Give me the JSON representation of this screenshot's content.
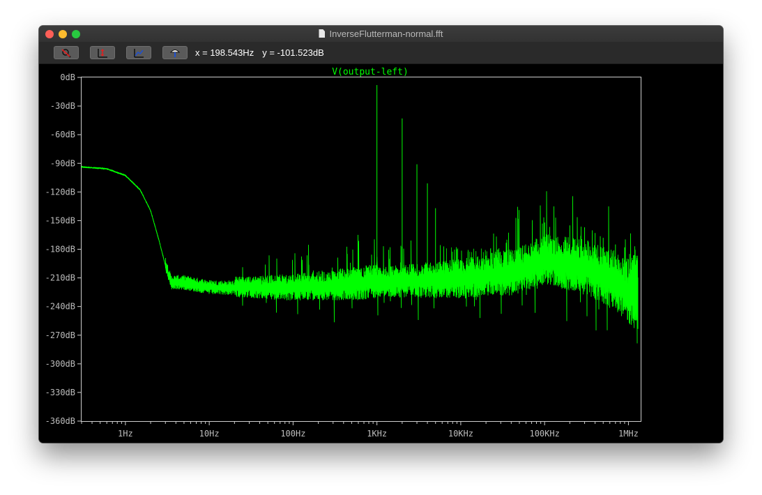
{
  "window": {
    "title": "InverseFlutterman-normal.fft"
  },
  "toolbar": {
    "buttons": [
      {
        "name": "zoom-cancel",
        "icon": "zoom-cancel-icon"
      },
      {
        "name": "autorange-y",
        "icon": "autorange-icon"
      },
      {
        "name": "toggle-grid",
        "icon": "grid-icon"
      },
      {
        "name": "pick-visible-traces",
        "icon": "probe-icon"
      }
    ],
    "cursor_x": "x = 198.543Hz",
    "cursor_y": "y = -101.523dB"
  },
  "chart_data": {
    "type": "line",
    "title": "V(output-left)",
    "x_scale": "log",
    "xlim": [
      0.3,
      1400000
    ],
    "ylim": [
      -360,
      0
    ],
    "x_tick_labels": [
      "1Hz",
      "10Hz",
      "100Hz",
      "1KHz",
      "10KHz",
      "100KHz",
      "1MHz"
    ],
    "x_ticks": [
      1,
      10,
      100,
      1000,
      10000,
      100000,
      1000000
    ],
    "y_ticks": [
      0,
      -30,
      -60,
      -90,
      -120,
      -150,
      -180,
      -210,
      -240,
      -270,
      -300,
      -330,
      -360
    ],
    "y_tick_labels": [
      "0dB",
      "-30dB",
      "-60dB",
      "-90dB",
      "-120dB",
      "-150dB",
      "-180dB",
      "-210dB",
      "-240dB",
      "-270dB",
      "-300dB",
      "-330dB",
      "-360dB"
    ],
    "trace_color": "#00ff00",
    "series": [
      {
        "name": "V(output-left)",
        "noise_floor": [
          {
            "f": 0.3,
            "db": -94
          },
          {
            "f": 0.6,
            "db": -96
          },
          {
            "f": 1.0,
            "db": -103
          },
          {
            "f": 1.5,
            "db": -118
          },
          {
            "f": 2.0,
            "db": -140
          },
          {
            "f": 2.5,
            "db": -170
          },
          {
            "f": 3.0,
            "db": -197
          },
          {
            "f": 3.5,
            "db": -217
          },
          {
            "f": 5.0,
            "db": -217
          },
          {
            "f": 10,
            "db": -222
          },
          {
            "f": 100,
            "db": -224
          },
          {
            "f": 500,
            "db": -221
          },
          {
            "f": 1000,
            "db": -219
          },
          {
            "f": 3000,
            "db": -218
          },
          {
            "f": 10000,
            "db": -217
          },
          {
            "f": 50000,
            "db": -210
          },
          {
            "f": 100000,
            "db": -198
          },
          {
            "f": 300000,
            "db": -207
          },
          {
            "f": 700000,
            "db": -222
          },
          {
            "f": 1000000,
            "db": -235
          },
          {
            "f": 1300000,
            "db": -243
          }
        ],
        "harmonics": [
          {
            "f": 1000,
            "db": -8
          },
          {
            "f": 2000,
            "db": -43
          },
          {
            "f": 3000,
            "db": -91
          },
          {
            "f": 4000,
            "db": -111
          },
          {
            "f": 5000,
            "db": -137
          },
          {
            "f": 100000,
            "db": -152
          },
          {
            "f": 200000,
            "db": -155
          },
          {
            "f": 300000,
            "db": -157
          },
          {
            "f": 400000,
            "db": -163
          },
          {
            "f": 500000,
            "db": -168
          },
          {
            "f": 700000,
            "db": -175
          },
          {
            "f": 900000,
            "db": -178
          }
        ]
      }
    ]
  }
}
